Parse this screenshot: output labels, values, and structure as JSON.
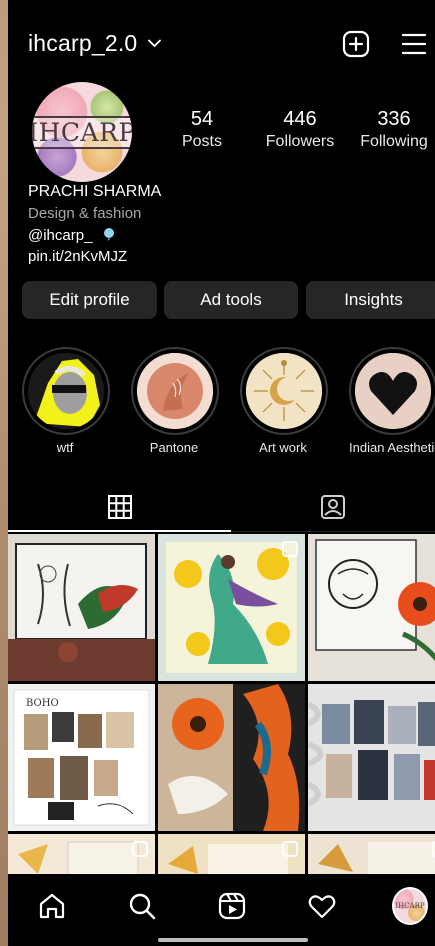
{
  "header": {
    "username": "ihcarp_2.0",
    "chevron": "⌄"
  },
  "profile": {
    "avatar_text": "IHCARP",
    "stats": {
      "posts": {
        "num": "54",
        "label": "Posts"
      },
      "followers": {
        "num": "446",
        "label": "Followers"
      },
      "following": {
        "num": "336",
        "label": "Following"
      }
    },
    "name": "PRACHI SHARMA",
    "category": "Design & fashion",
    "threads_handle": "@ihcarp_",
    "link": "pin.it/2nKvMJZ"
  },
  "buttons": {
    "edit": "Edit profile",
    "ad_tools": "Ad tools",
    "insights": "Insights"
  },
  "highlights": [
    {
      "label": "wtf"
    },
    {
      "label": "Pantone"
    },
    {
      "label": "Art work"
    },
    {
      "label": "Indian Aesthetic"
    }
  ],
  "post_count_visible": 9,
  "icons": {
    "chevron": "chevron-down-icon",
    "add": "add-square-icon",
    "menu": "hamburger-menu-icon",
    "threads": "threads-icon",
    "grid": "grid-icon",
    "tagged": "tagged-person-icon",
    "home": "home-icon",
    "search": "search-icon",
    "reels": "reels-icon",
    "heart": "heart-icon"
  },
  "colors": {
    "background": "#000000",
    "button": "#262626",
    "secondary_text": "#a8a8a8"
  }
}
